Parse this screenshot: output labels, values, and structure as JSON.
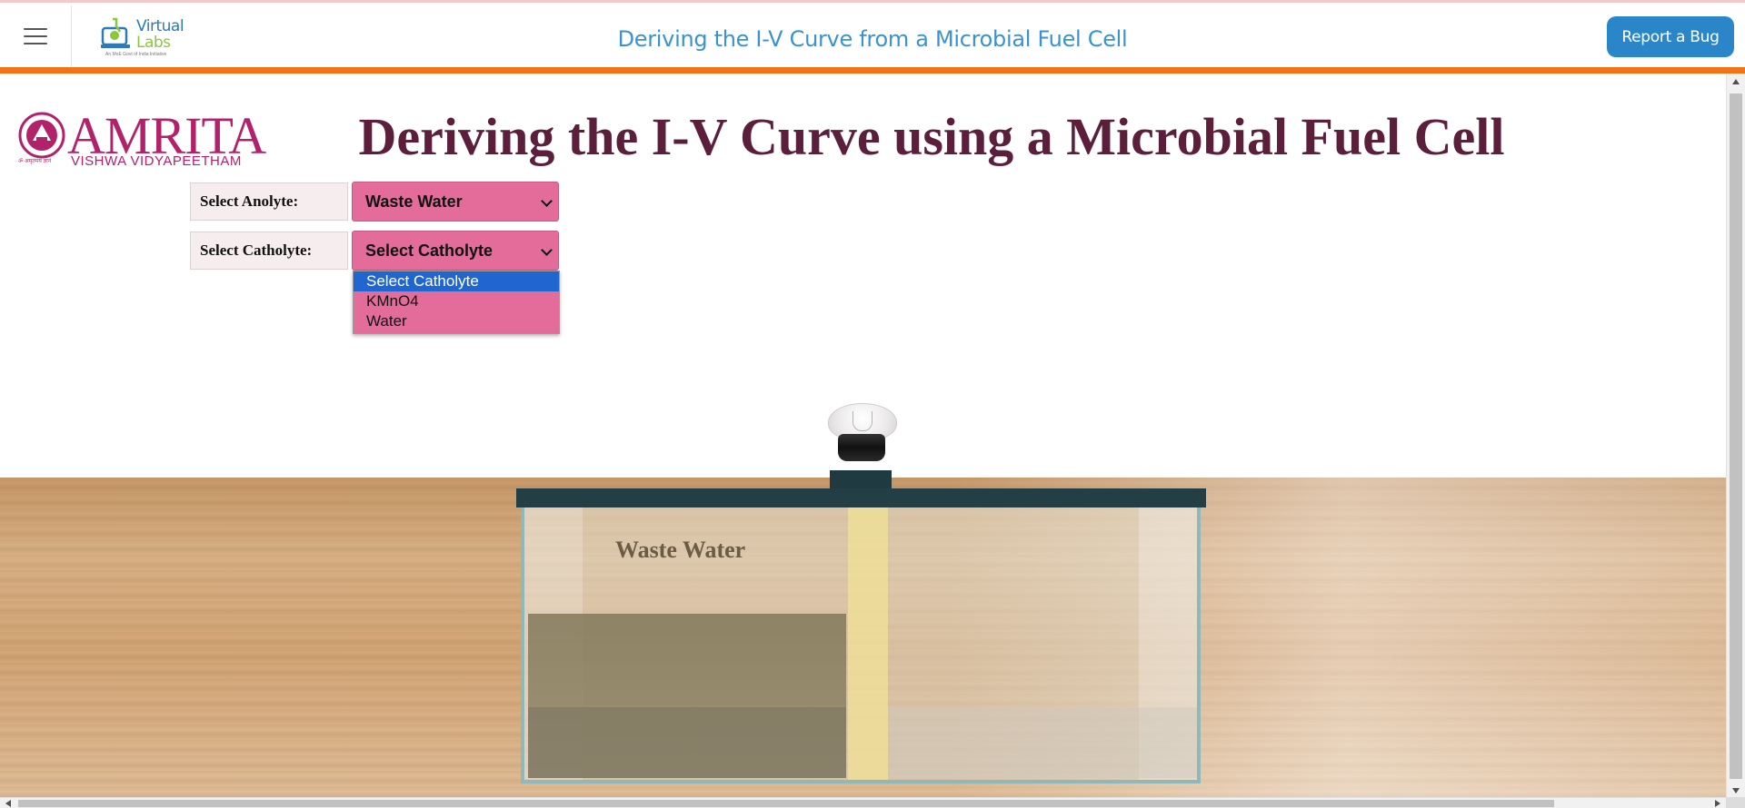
{
  "header": {
    "logo": {
      "line1": "Virtual",
      "line2": "Labs",
      "tagline": "An MoE Govt of India Initiative"
    },
    "title": "Deriving the I-V Curve from a Microbial Fuel Cell",
    "report_bug_label": "Report a Bug"
  },
  "brand": {
    "name": "AMRITA",
    "subtitle": "VISHWA VIDYAPEETHAM",
    "small_text": "ॐ अमृतमय ज्ञानं"
  },
  "experiment": {
    "title": "Deriving the I-V Curve using a Microbial Fuel Cell",
    "anolyte": {
      "label": "Select Anolyte:",
      "value": "Waste Water"
    },
    "catholyte": {
      "label": "Select Catholyte:",
      "value": "Select Catholyte",
      "options": [
        "Select Catholyte",
        "KMnO4",
        "Water"
      ],
      "highlighted_option": "Select Catholyte"
    },
    "tank_label": "Waste Water"
  },
  "colors": {
    "accent_orange": "#f47216",
    "title_blue": "#3a93cf",
    "button_blue": "#2a86c8",
    "amrita_magenta": "#b2226b",
    "heading_maroon": "#5b1f3b",
    "select_pink": "#e46c9b",
    "option_highlight": "#1f66d1"
  },
  "icons": {
    "menu": "hamburger-icon",
    "dropdown": "chevron-down-icon"
  }
}
